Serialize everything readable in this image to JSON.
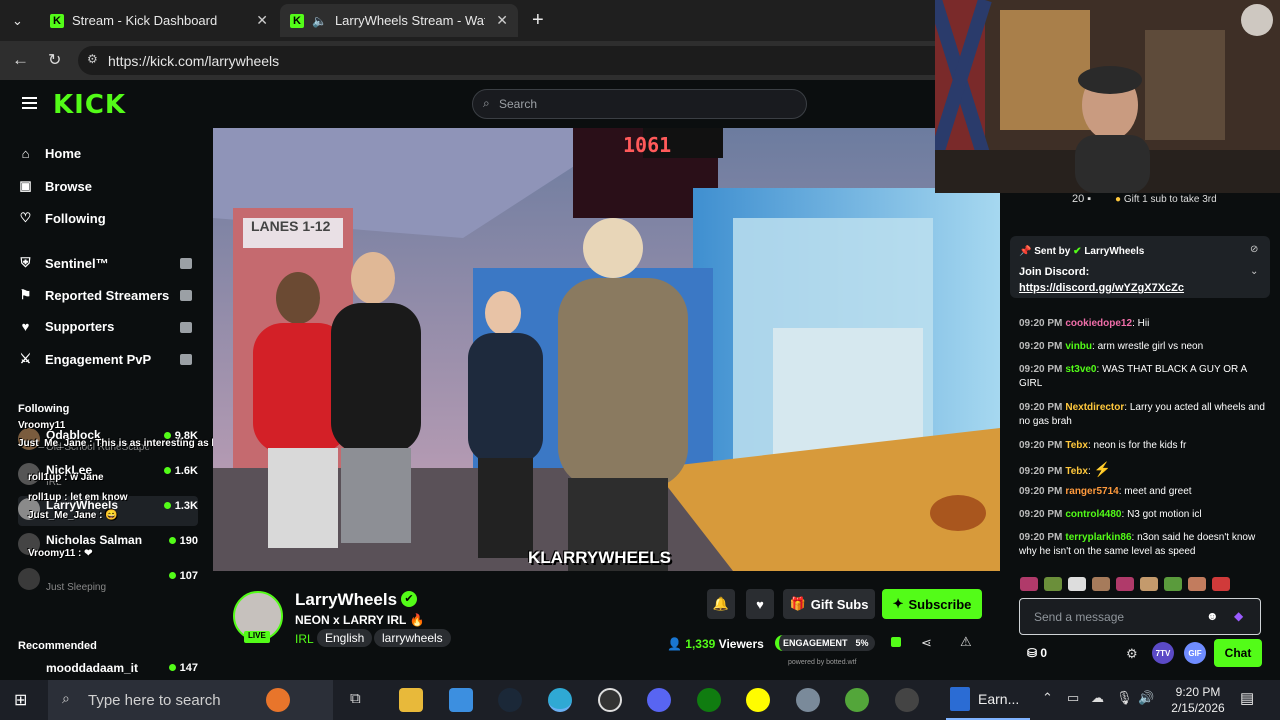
{
  "browser": {
    "tabs": [
      {
        "label": "Stream - Kick Dashboard"
      },
      {
        "label": "LarryWheels Stream - Watch Liv"
      }
    ],
    "url": "https://kick.com/larrywheels"
  },
  "kick": {
    "logo": "KICK",
    "search_placeholder": "Search"
  },
  "sidebar": {
    "nav": [
      {
        "label": "Home",
        "icon": "home-icon"
      },
      {
        "label": "Browse",
        "icon": "browse-icon"
      },
      {
        "label": "Following",
        "icon": "heart-icon"
      }
    ],
    "mod_tools": [
      {
        "label": "Sentinel™"
      },
      {
        "label": "Reported Streamers"
      },
      {
        "label": "Supporters"
      },
      {
        "label": "Engagement PvP"
      }
    ],
    "following_title": "Following",
    "following": [
      {
        "name": "Odablock",
        "sub": "Old School RuneScape",
        "viewers": "9.8K"
      },
      {
        "name": "NickLee",
        "sub": "IRL",
        "viewers": "1.6K"
      },
      {
        "name": "LarryWheels",
        "sub": "",
        "viewers": "1.3K"
      },
      {
        "name": "Nicholas Salman",
        "sub": "",
        "viewers": "190"
      },
      {
        "name": "",
        "sub": "Just Sleeping",
        "viewers": "107"
      }
    ],
    "recommended_title": "Recommended",
    "recommended": [
      {
        "name": "mooddadaam_it",
        "viewers": "147"
      }
    ]
  },
  "overlay_chat": [
    {
      "u": "Vroomy11",
      "m": ""
    },
    {
      "u": "Just_Me_Jane",
      "m": "This is as interesting as listening to xQc"
    },
    {
      "u": "roll1up",
      "m": "w Jane"
    },
    {
      "u": "roll1up",
      "m": "let em know"
    },
    {
      "u": "Just_Me_Jane",
      "m": ""
    },
    {
      "u": "Vroomy11",
      "m": ""
    }
  ],
  "video": {
    "watermark": "KLARRYWHEELS",
    "sign_lanes": "LANES 1-12",
    "score": "1061"
  },
  "streamer": {
    "name": "LarryWheels",
    "title": "NEON x LARRY IRL 🔥",
    "category": "IRL",
    "live_label": "LIVE",
    "tags": [
      "English",
      "larrywheels"
    ],
    "viewers": "1,339",
    "viewers_label": "Viewers",
    "gift_label": "Gift Subs",
    "subscribe_label": "Subscribe",
    "engagement_label": "ENGAGEMENT",
    "engagement_value": "5%",
    "powered": "powered by botted.wtf"
  },
  "chat": {
    "leaderboard": {
      "count": "20",
      "gift_text": "Gift 1 sub to take 3rd"
    },
    "pinned": {
      "sent_by": "Sent by",
      "user": "LarryWheels",
      "title": "Join Discord:",
      "link": "https://discord.gg/wYZgX7XcZc"
    },
    "messages": [
      {
        "t": "09:20 PM",
        "u": "cookiedope12",
        "c": "#f06ea9",
        "m": "Hii"
      },
      {
        "t": "09:20 PM",
        "u": "vinbu",
        "c": "#53fc18",
        "m": "arm wrestle girl vs neon"
      },
      {
        "t": "09:20 PM",
        "u": "st3ve0",
        "c": "#53fc18",
        "m": "WAS THAT BLACK A GUY OR A GIRL"
      },
      {
        "t": "09:20 PM",
        "u": "Nextdirector",
        "c": "#ffc83d",
        "m": "Larry you acted all wheels and no gas brah"
      },
      {
        "t": "09:20 PM",
        "u": "Tebx",
        "c": "#ffc83d",
        "m": "neon is for the kids fr"
      },
      {
        "t": "09:20 PM",
        "u": "Tebx",
        "c": "#ffc83d",
        "m": "⚡"
      },
      {
        "t": "09:20 PM",
        "u": "ranger5714",
        "c": "#ff9a3d",
        "m": "meet and greet"
      },
      {
        "t": "09:20 PM",
        "u": "control4480",
        "c": "#53fc18",
        "m": "N3 got motion icl"
      },
      {
        "t": "09:20 PM",
        "u": "terryplarkin86",
        "c": "#53fc18",
        "m": "n3on said he doesn't know why he isn't on the same level as speed"
      }
    ],
    "input_placeholder": "Send a message",
    "points": "0",
    "chat_button": "Chat"
  },
  "taskbar": {
    "search_placeholder": "Type here to search",
    "app_label": "Earn...",
    "time": "9:20 PM",
    "date": "2/15/2026"
  }
}
